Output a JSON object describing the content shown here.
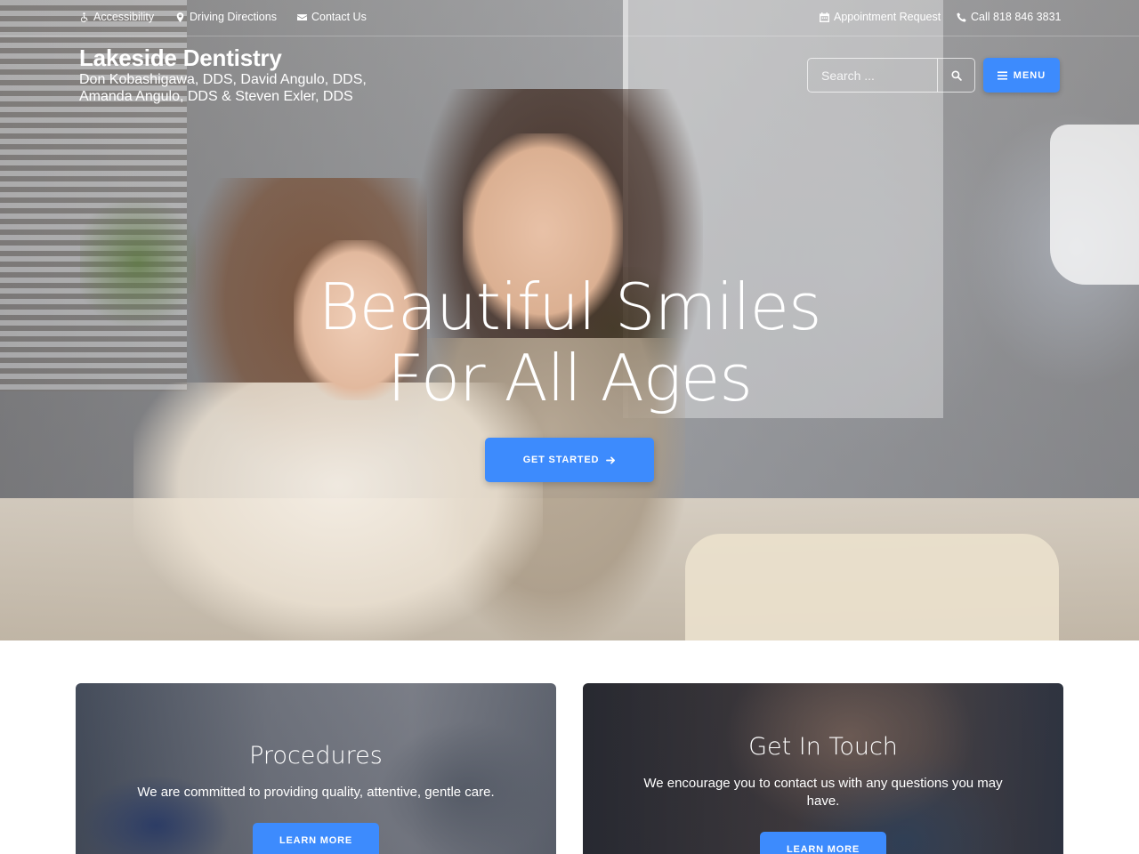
{
  "topbar": {
    "accessibility": "Accessibility",
    "directions": "Driving Directions",
    "contact": "Contact Us",
    "appointment": "Appointment Request",
    "call": "Call 818 846 3831"
  },
  "brand": {
    "title": "Lakeside Dentistry",
    "subtitle": "Don Kobashigawa, DDS, David Angulo, DDS, Amanda Angulo, DDS & Steven Exler, DDS"
  },
  "search": {
    "placeholder": "Search ..."
  },
  "menu": {
    "label": "MENU"
  },
  "hero": {
    "line1": "Beautiful Smiles",
    "line2": "For All Ages",
    "cta_label": "GET STARTED"
  },
  "cards": {
    "procedures": {
      "title": "Procedures",
      "text": "We are committed to providing quality, attentive, gentle care.",
      "button": "LEARN MORE"
    },
    "contact": {
      "title": "Get In Touch",
      "text": "We encourage you to contact us with any questions you may have.",
      "button": "LEARN MORE"
    }
  },
  "icons": {
    "accessibility": "wheelchair-icon",
    "directions": "map-marker-icon",
    "contact": "envelope-icon",
    "appointment": "calendar-icon",
    "call": "phone-icon",
    "search": "search-icon",
    "menu": "bars-icon",
    "cta": "arrow-right-icon"
  },
  "colors": {
    "accent": "#3d8bfd",
    "text_on_image": "#ffffff"
  }
}
